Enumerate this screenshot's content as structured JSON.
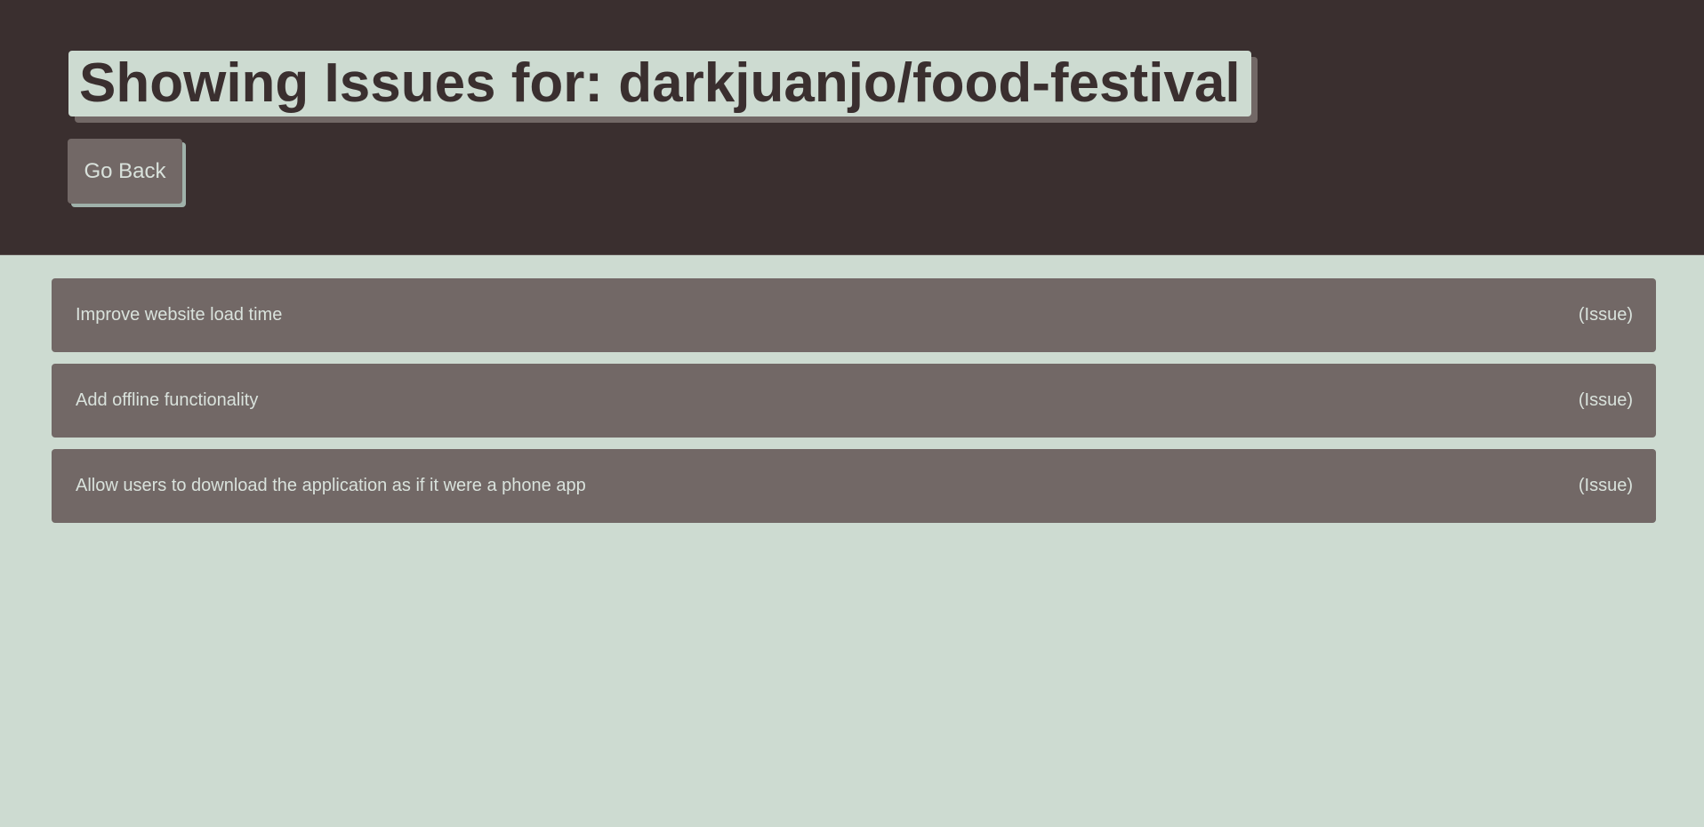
{
  "header": {
    "title": "Showing Issues for: darkjuanjo/food-festival",
    "back_button_label": "Go Back"
  },
  "issues": [
    {
      "title": "Improve website load time",
      "type": "(Issue)"
    },
    {
      "title": "Add offline functionality",
      "type": "(Issue)"
    },
    {
      "title": "Allow users to download the application as if it were a phone app",
      "type": "(Issue)"
    }
  ],
  "colors": {
    "header_bg": "#3a2f2f",
    "page_bg": "#cddbd1",
    "card_bg": "#726866",
    "text_light": "#d9e2dc"
  }
}
